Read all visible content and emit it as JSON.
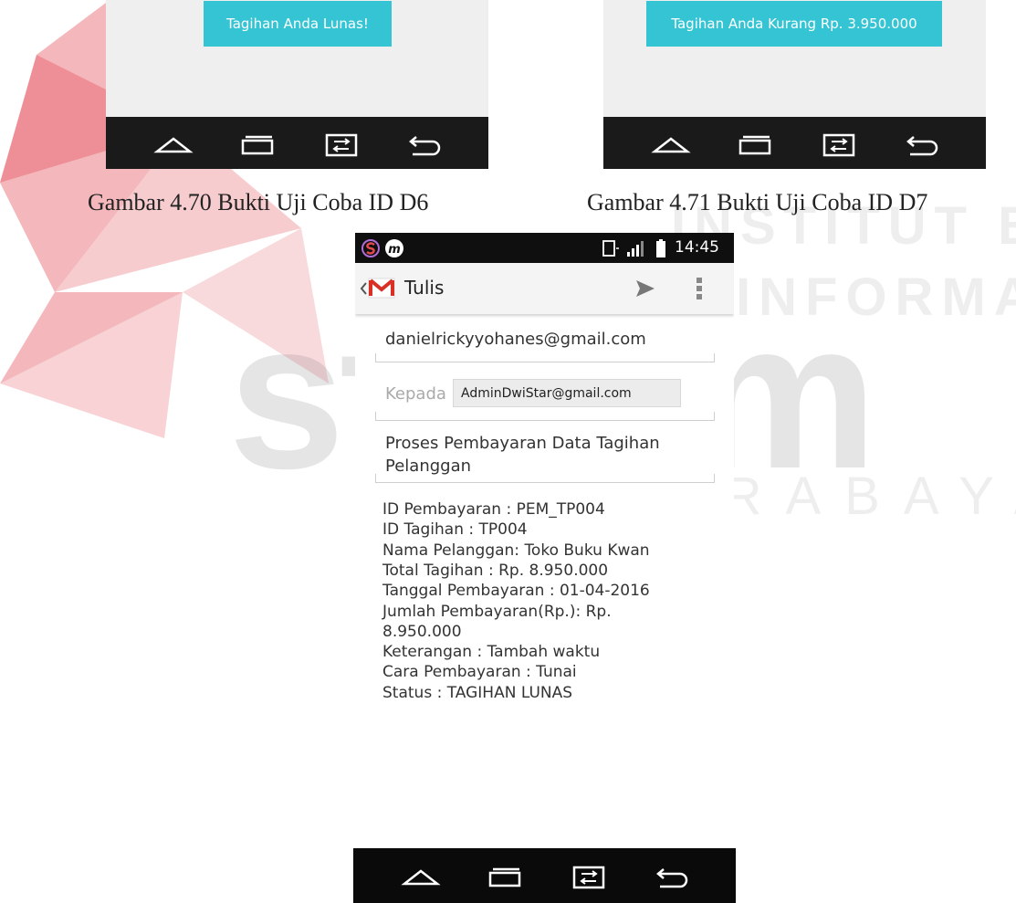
{
  "watermark": {
    "line1": "INSTITUT BISNIS",
    "line2": "& INFORMATIKA",
    "brand": "stikom",
    "city": "SURABAYA"
  },
  "screenshot_left": {
    "toast": "Tagihan Anda Lunas!",
    "caption": "Gambar 4.70 Bukti Uji Coba ID D6"
  },
  "screenshot_right": {
    "toast": "Tagihan Anda Kurang Rp. 3.950.000",
    "caption": "Gambar 4.71 Bukti Uji Coba ID D7"
  },
  "compose": {
    "status_time": "14:45",
    "app_title": "Tulis",
    "from": "danielrickyyohanes@gmail.com",
    "to_label": "Kepada",
    "to_value": "AdminDwiStar@gmail.com",
    "subject_line1": "Proses Pembayaran Data Tagihan",
    "subject_line2": "Pelanggan",
    "body_lines": [
      "ID Pembayaran : PEM_TP004",
      "ID Tagihan : TP004",
      "Nama Pelanggan: Toko Buku Kwan",
      "Total Tagihan : Rp. 8.950.000",
      "Tanggal Pembayaran : 01-04-2016",
      "Jumlah Pembayaran(Rp.): Rp.",
      "8.950.000",
      "Keterangan : Tambah waktu",
      "Cara Pembayaran : Tunai",
      "Status : TAGIHAN LUNAS"
    ]
  },
  "icons": {
    "nav": [
      "home-icon",
      "recent-apps-icon",
      "dual-window-icon",
      "back-icon"
    ],
    "status": [
      "s-app-icon",
      "m-app-icon",
      "signal-icon",
      "battery-icon"
    ],
    "appbar": [
      "chevron-left-icon",
      "gmail-icon",
      "send-icon",
      "overflow-menu-icon"
    ]
  },
  "colors": {
    "toast": "#35c4d4",
    "navbar": "#1a1a1a",
    "gmail_red": "#d93025",
    "watermark_red": "#e0323f",
    "cursor_line": "#2aa8b8"
  }
}
